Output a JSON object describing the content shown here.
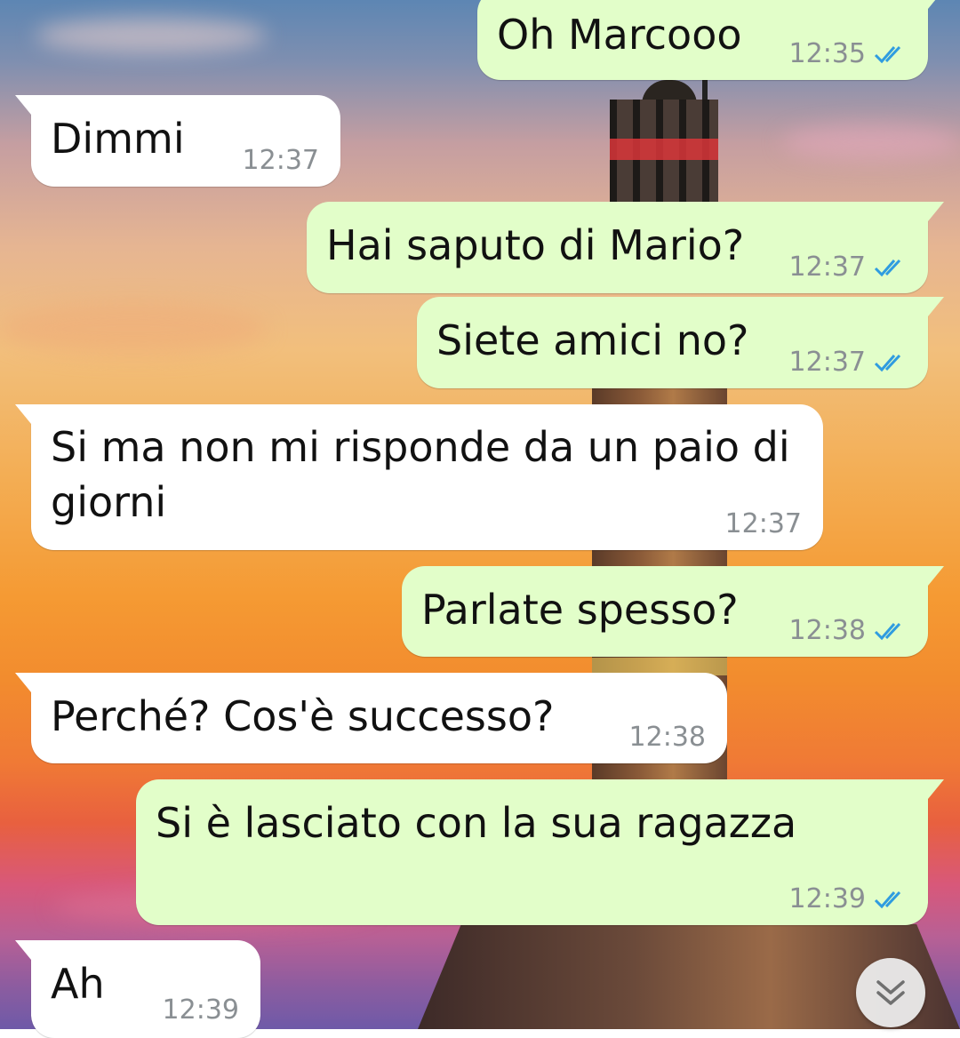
{
  "colors": {
    "incoming_bubble": "#ffffff",
    "outgoing_bubble": "#e2fec9",
    "read_ticks": "#2f9ce0",
    "timestamp": "#8a8f93"
  },
  "messages": [
    {
      "direction": "outgoing",
      "text": "Oh Marcooo",
      "time": "12:35",
      "status": "read"
    },
    {
      "direction": "incoming",
      "text": "Dimmi",
      "time": "12:37"
    },
    {
      "direction": "outgoing",
      "text": "Hai saputo di Mario?",
      "time": "12:37",
      "status": "read"
    },
    {
      "direction": "outgoing",
      "text": "Siete amici no?",
      "time": "12:37",
      "status": "read"
    },
    {
      "direction": "incoming",
      "text": "Si ma non mi risponde da un paio di\ngiorni",
      "time": "12:37"
    },
    {
      "direction": "outgoing",
      "text": "Parlate spesso?",
      "time": "12:38",
      "status": "read"
    },
    {
      "direction": "incoming",
      "text": "Perché? Cos'è successo?",
      "time": "12:38"
    },
    {
      "direction": "outgoing",
      "text": "Si è lasciato con la sua ragazza",
      "time": "12:39",
      "status": "read"
    },
    {
      "direction": "incoming",
      "text": "Ah",
      "time": "12:39"
    }
  ],
  "scroll_button": {
    "icon": "double-chevron-down-icon"
  }
}
